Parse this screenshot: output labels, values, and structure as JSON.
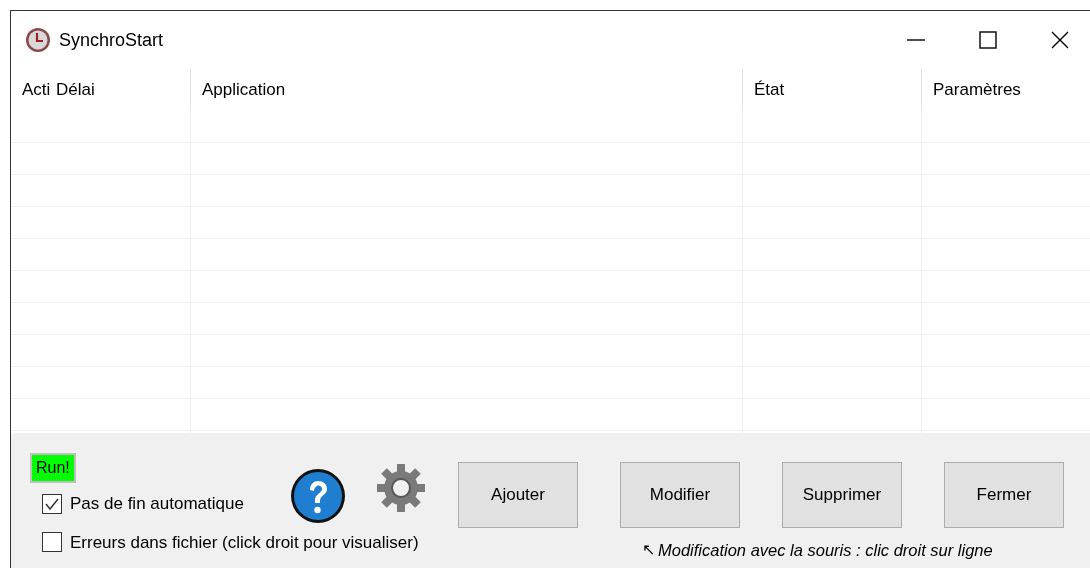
{
  "window": {
    "title": "SynchroStart"
  },
  "table": {
    "columns": [
      "Acti",
      "Délai",
      "Application",
      "État",
      "Paramètres"
    ]
  },
  "run_indicator": {
    "text": "Run!"
  },
  "options": [
    {
      "label": "Pas de fin automatique",
      "checked": true
    },
    {
      "label": "Erreurs dans fichier (click droit pour visualiser)",
      "checked": false
    }
  ],
  "buttons": [
    "Ajouter",
    "Modifier",
    "Supprimer",
    "Fermer"
  ],
  "hint": {
    "arrow": "↖",
    "text": "Modification avec la souris : clic droit sur ligne"
  }
}
